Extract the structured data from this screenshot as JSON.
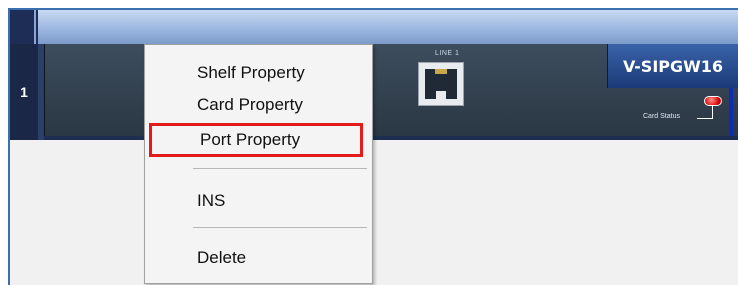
{
  "shelf": {
    "slot_number": "1"
  },
  "card": {
    "title": "V-SIPGW16",
    "port_label": "LINE 1",
    "status_label": "Card Status",
    "status_color": "#d10000"
  },
  "context_menu": {
    "items": [
      {
        "label": "Shelf Property"
      },
      {
        "label": "Card Property"
      },
      {
        "label": "Port Property",
        "highlighted": true
      },
      {
        "label": "INS"
      },
      {
        "label": "Delete"
      }
    ],
    "highlight_color": "#e41b1b"
  }
}
